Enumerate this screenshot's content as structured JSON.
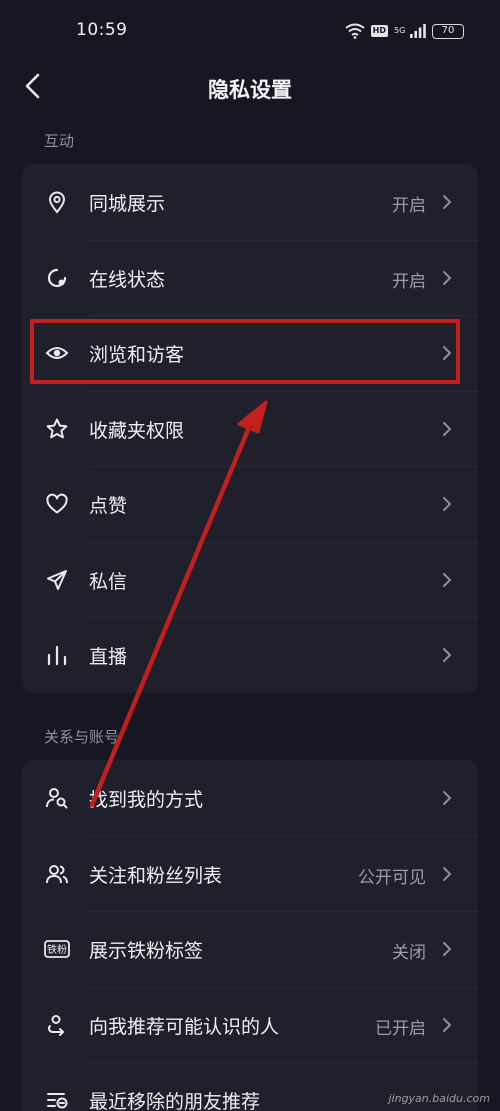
{
  "status_bar": {
    "time": "10:59",
    "hd_badge": "HD",
    "network": "5G",
    "battery": "70"
  },
  "header": {
    "title": "隐私设置",
    "back_icon": "chevron-left-icon"
  },
  "sections": [
    {
      "label": "互动",
      "items": [
        {
          "label": "同城展示",
          "value": "开启",
          "icon": "location-pin-icon"
        },
        {
          "label": "在线状态",
          "value": "开启",
          "icon": "online-status-icon"
        },
        {
          "label": "浏览和访客",
          "value": "",
          "icon": "eye-icon",
          "highlighted": true
        },
        {
          "label": "收藏夹权限",
          "value": "",
          "icon": "star-icon"
        },
        {
          "label": "点赞",
          "value": "",
          "icon": "heart-icon"
        },
        {
          "label": "私信",
          "value": "",
          "icon": "send-icon"
        },
        {
          "label": "直播",
          "value": "",
          "icon": "live-bars-icon"
        }
      ]
    },
    {
      "label": "关系与账号",
      "items": [
        {
          "label": "找到我的方式",
          "value": "",
          "icon": "user-search-icon"
        },
        {
          "label": "关注和粉丝列表",
          "value": "公开可见",
          "icon": "users-icon"
        },
        {
          "label": "展示铁粉标签",
          "value": "关闭",
          "icon": "fan-badge-icon",
          "badge_text": "铁粉"
        },
        {
          "label": "向我推荐可能认识的人",
          "value": "已开启",
          "icon": "recommend-people-icon"
        },
        {
          "label": "最近移除的朋友推荐",
          "value": "",
          "icon": "removed-list-icon"
        }
      ]
    }
  ],
  "annotation": {
    "color": "#c21f1f"
  },
  "watermark": "jingyan.baidu.com"
}
